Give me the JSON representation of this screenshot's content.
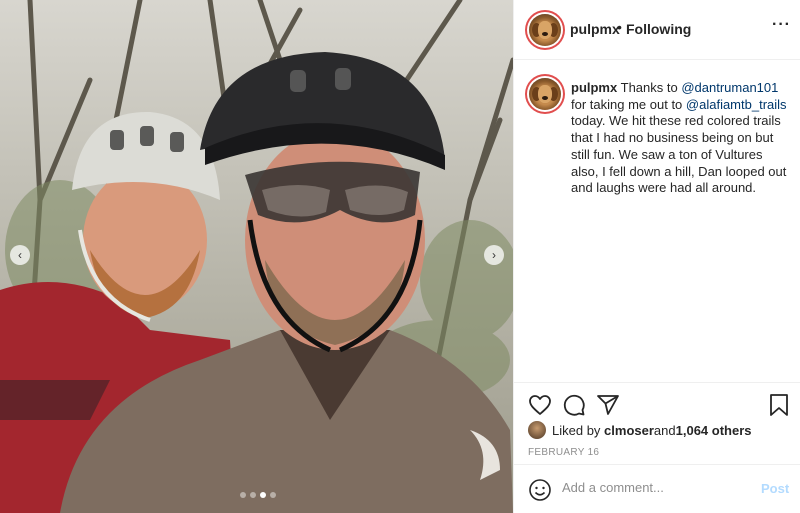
{
  "post": {
    "username": "pulpmx",
    "separator": "•",
    "follow_status": "Following",
    "more_icon": "more-horizontal-icon",
    "more_glyph": "···"
  },
  "caption": {
    "username": "pulpmx",
    "part1": "Thanks to ",
    "mention1": "@dantruman101",
    "part2": " for taking me out to ",
    "mention2": "@alafiamtb_trails",
    "part3": " today. We hit these red colored trails that I had no business being on but still fun. We saw a ton of Vultures also, I fell down a hill, Dan looped out and laughs were had all around."
  },
  "carousel": {
    "prev_glyph": "‹",
    "next_glyph": "›",
    "slide_count": 4,
    "active_index": 2
  },
  "actions": {
    "icons": [
      "heart-icon",
      "comment-icon",
      "share-icon",
      "bookmark-icon"
    ]
  },
  "likes": {
    "prefix": "Liked by ",
    "user": "clmoser",
    "middle": " and ",
    "count_text": "1,064 others"
  },
  "date": "FEBRUARY 16",
  "comment_box": {
    "placeholder": "Add a comment...",
    "post_label": "Post"
  },
  "colors": {
    "mention": "#00376b",
    "post_disabled": "#b3dbff",
    "muted": "#8e8e8e",
    "story_ring": "#e14e4e"
  }
}
